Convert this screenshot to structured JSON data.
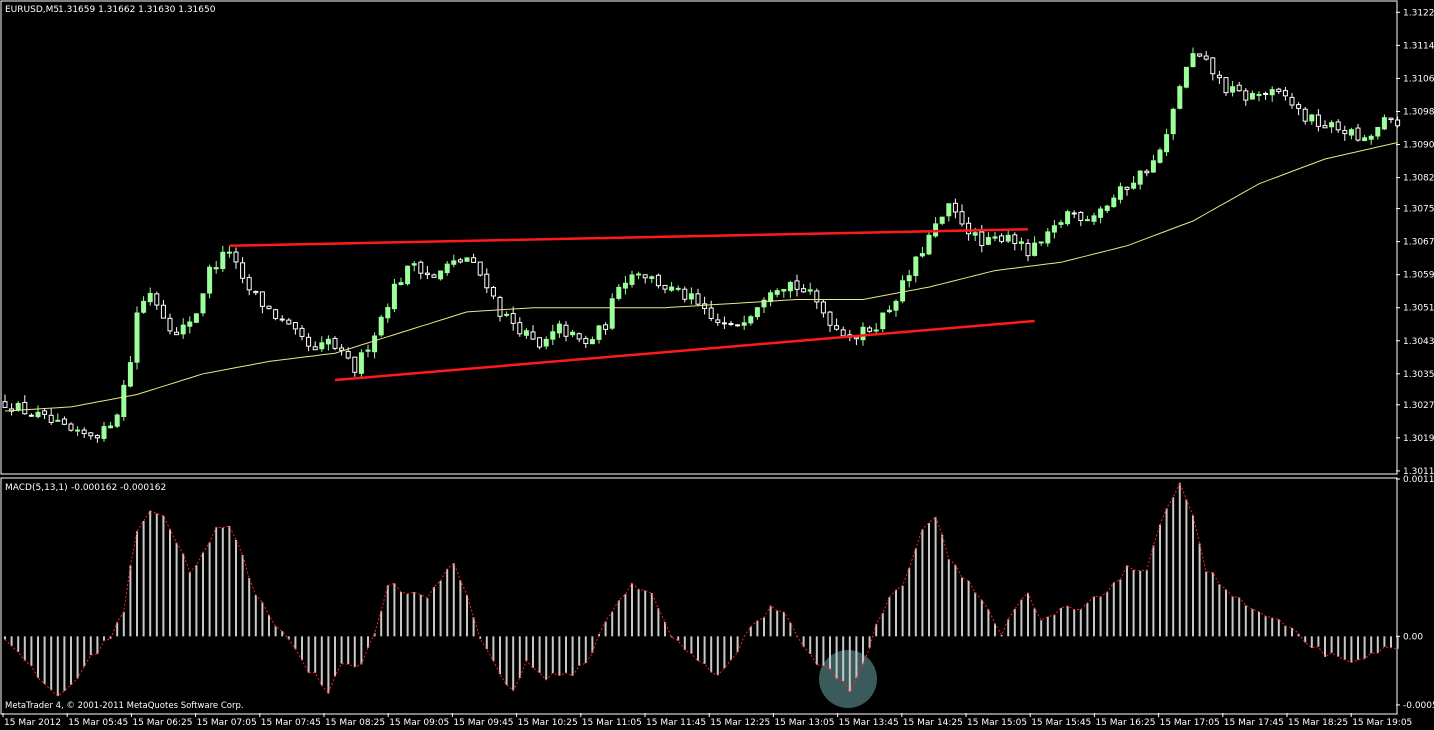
{
  "header": {
    "symbol": "EURUSD,M5",
    "ohlc": "1.31659 1.31662 1.31630 1.31650"
  },
  "macd_header": {
    "label": "MACD(5,13,1)",
    "values": "-0.000162 -0.000162"
  },
  "footer": {
    "copyright": "MetaTrader 4, © 2001-2011 MetaQuotes Software Corp."
  },
  "colors": {
    "background": "#000000",
    "grid": "#ffffff",
    "bull": "#9cff9c",
    "bear": "#ffffff",
    "ma": "#e8e88a",
    "trendline": "#ff1a1a",
    "macd_bar": "#c8c8c8",
    "signal": "#ff2020",
    "highlight": "#3a5a5c"
  },
  "chart_data": [
    {
      "type": "candlestick",
      "title": "EURUSD,M5",
      "price_axis_labels": [
        "1.31225",
        "1.31145",
        "1.31065",
        "1.30985",
        "1.30905",
        "1.30825",
        "1.30750",
        "1.30670",
        "1.30590",
        "1.30510",
        "1.30430",
        "1.30350",
        "1.30275",
        "1.30195",
        "1.30115"
      ],
      "ylim": [
        1.3011,
        1.3125
      ],
      "x_axis_labels": [
        "15 Mar 2012",
        "15 Mar 05:45",
        "15 Mar 06:25",
        "15 Mar 07:05",
        "15 Mar 07:45",
        "15 Mar 08:25",
        "15 Mar 09:05",
        "15 Mar 09:45",
        "15 Mar 10:25",
        "15 Mar 11:05",
        "15 Mar 11:45",
        "15 Mar 12:25",
        "15 Mar 13:05",
        "15 Mar 13:45",
        "15 Mar 14:25",
        "15 Mar 15:05",
        "15 Mar 15:45",
        "15 Mar 16:25",
        "15 Mar 17:05",
        "15 Mar 17:45",
        "15 Mar 18:25",
        "15 Mar 19:05"
      ],
      "close_path": [
        [
          0,
          1.3028
        ],
        [
          6,
          1.3024
        ],
        [
          11,
          1.302
        ],
        [
          15,
          1.3021
        ],
        [
          17,
          1.3026
        ],
        [
          19,
          1.3038
        ],
        [
          20,
          1.305
        ],
        [
          22,
          1.3055
        ],
        [
          26,
          1.3044
        ],
        [
          29,
          1.305
        ],
        [
          31,
          1.306
        ],
        [
          34,
          1.3065
        ],
        [
          36,
          1.3057
        ],
        [
          39,
          1.3052
        ],
        [
          43,
          1.3046
        ],
        [
          47,
          1.304
        ],
        [
          49,
          1.3043
        ],
        [
          53,
          1.3036
        ],
        [
          56,
          1.3045
        ],
        [
          59,
          1.3056
        ],
        [
          62,
          1.3062
        ],
        [
          65,
          1.3058
        ],
        [
          67,
          1.3061
        ],
        [
          70,
          1.3063
        ],
        [
          73,
          1.3057
        ],
        [
          75,
          1.305
        ],
        [
          78,
          1.3046
        ],
        [
          81,
          1.3041
        ],
        [
          84,
          1.3046
        ],
        [
          88,
          1.3042
        ],
        [
          91,
          1.3047
        ],
        [
          93,
          1.3057
        ],
        [
          96,
          1.306
        ],
        [
          100,
          1.3056
        ],
        [
          104,
          1.3053
        ],
        [
          107,
          1.3048
        ],
        [
          110,
          1.3046
        ],
        [
          113,
          1.305
        ],
        [
          116,
          1.3056
        ],
        [
          119,
          1.3057
        ],
        [
          122,
          1.3054
        ],
        [
          126,
          1.3046
        ],
        [
          129,
          1.3044
        ],
        [
          132,
          1.3047
        ],
        [
          134,
          1.3051
        ],
        [
          137,
          1.3059
        ],
        [
          140,
          1.3068
        ],
        [
          143,
          1.3075
        ],
        [
          145,
          1.3072
        ],
        [
          148,
          1.3066
        ],
        [
          152,
          1.3069
        ],
        [
          155,
          1.3064
        ],
        [
          158,
          1.3068
        ],
        [
          161,
          1.3074
        ],
        [
          164,
          1.3073
        ],
        [
          167,
          1.3076
        ],
        [
          171,
          1.3082
        ],
        [
          174,
          1.3086
        ],
        [
          176,
          1.3092
        ],
        [
          178,
          1.3105
        ],
        [
          180,
          1.3112
        ],
        [
          182,
          1.311
        ],
        [
          185,
          1.3104
        ],
        [
          188,
          1.3102
        ],
        [
          191,
          1.3103
        ],
        [
          194,
          1.3102
        ],
        [
          197,
          1.3097
        ],
        [
          200,
          1.3095
        ],
        [
          203,
          1.3094
        ],
        [
          206,
          1.3091
        ],
        [
          209,
          1.3096
        ],
        [
          211,
          1.3095
        ]
      ],
      "ma_path": [
        [
          0,
          1.3026
        ],
        [
          10,
          1.3027
        ],
        [
          20,
          1.303
        ],
        [
          30,
          1.3035
        ],
        [
          40,
          1.3038
        ],
        [
          50,
          1.304
        ],
        [
          60,
          1.3045
        ],
        [
          70,
          1.305
        ],
        [
          80,
          1.3051
        ],
        [
          90,
          1.3051
        ],
        [
          100,
          1.3051
        ],
        [
          110,
          1.3052
        ],
        [
          120,
          1.3053
        ],
        [
          130,
          1.3053
        ],
        [
          140,
          1.3056
        ],
        [
          150,
          1.306
        ],
        [
          160,
          1.3062
        ],
        [
          170,
          1.3066
        ],
        [
          180,
          1.3072
        ],
        [
          190,
          1.3081
        ],
        [
          200,
          1.3087
        ],
        [
          211,
          1.3091
        ]
      ],
      "trendlines": [
        {
          "from": [
            34,
            1.3066
          ],
          "to": [
            155,
            1.307
          ]
        },
        {
          "from": [
            50,
            1.30335
          ],
          "to": [
            156,
            1.30478
          ]
        }
      ]
    },
    {
      "type": "histogram",
      "title": "MACD(5,13,1)",
      "value_axis_labels": [
        "0.00117",
        "0.00",
        "-0.00051"
      ],
      "ylim": [
        -0.00057,
        0.00117
      ],
      "signal": "dotted",
      "keyframes": [
        [
          0,
          0.0
        ],
        [
          3,
          -0.0002
        ],
        [
          8,
          -0.00045
        ],
        [
          11,
          -0.0003
        ],
        [
          14,
          -0.0001
        ],
        [
          16,
          0.0
        ],
        [
          18,
          0.0002
        ],
        [
          20,
          0.0008
        ],
        [
          22,
          0.00095
        ],
        [
          24,
          0.0009
        ],
        [
          26,
          0.0007
        ],
        [
          28,
          0.0005
        ],
        [
          30,
          0.0006
        ],
        [
          32,
          0.0008
        ],
        [
          34,
          0.0008
        ],
        [
          36,
          0.0006
        ],
        [
          38,
          0.0003
        ],
        [
          41,
          0.0001
        ],
        [
          43,
          0.0
        ],
        [
          45,
          -0.0002
        ],
        [
          47,
          -0.0003
        ],
        [
          49,
          -0.0004
        ],
        [
          51,
          -0.0002
        ],
        [
          54,
          -0.0002
        ],
        [
          56,
          0.0
        ],
        [
          58,
          0.0004
        ],
        [
          61,
          0.0003
        ],
        [
          64,
          0.0003
        ],
        [
          68,
          0.00055
        ],
        [
          70,
          0.0003
        ],
        [
          72,
          0.0
        ],
        [
          74,
          -0.0002
        ],
        [
          77,
          -0.0004
        ],
        [
          79,
          -0.0002
        ],
        [
          82,
          -0.0003
        ],
        [
          85,
          -0.0003
        ],
        [
          88,
          -0.0002
        ],
        [
          90,
          0.0
        ],
        [
          92,
          0.0002
        ],
        [
          95,
          0.0004
        ],
        [
          98,
          0.0003
        ],
        [
          101,
          0.0
        ],
        [
          103,
          -0.0001
        ],
        [
          106,
          -0.0002
        ],
        [
          108,
          -0.0003
        ],
        [
          110,
          -0.0002
        ],
        [
          113,
          0.0001
        ],
        [
          116,
          0.0002
        ],
        [
          118,
          0.0002
        ],
        [
          120,
          0.0
        ],
        [
          123,
          -0.0002
        ],
        [
          126,
          -0.0003
        ],
        [
          128,
          -0.0004
        ],
        [
          130,
          -0.0002
        ],
        [
          133,
          0.0002
        ],
        [
          136,
          0.0004
        ],
        [
          139,
          0.0008
        ],
        [
          141,
          0.0009
        ],
        [
          143,
          0.0006
        ],
        [
          146,
          0.0004
        ],
        [
          149,
          0.0002
        ],
        [
          151,
          0.0
        ],
        [
          153,
          0.0002
        ],
        [
          155,
          0.0003
        ],
        [
          157,
          0.0001
        ],
        [
          160,
          0.0002
        ],
        [
          163,
          0.0002
        ],
        [
          166,
          0.0003
        ],
        [
          168,
          0.0004
        ],
        [
          170,
          0.0005
        ],
        [
          173,
          0.0005
        ],
        [
          175,
          0.0008
        ],
        [
          178,
          0.00117
        ],
        [
          180,
          0.0009
        ],
        [
          182,
          0.0005
        ],
        [
          186,
          0.0003
        ],
        [
          189,
          0.0002
        ],
        [
          193,
          0.0001
        ],
        [
          196,
          0.0
        ],
        [
          199,
          -0.0001
        ],
        [
          203,
          -0.0002
        ],
        [
          205,
          -0.0002
        ],
        [
          208,
          -0.0001
        ],
        [
          211,
          -0.0001
        ]
      ]
    }
  ]
}
